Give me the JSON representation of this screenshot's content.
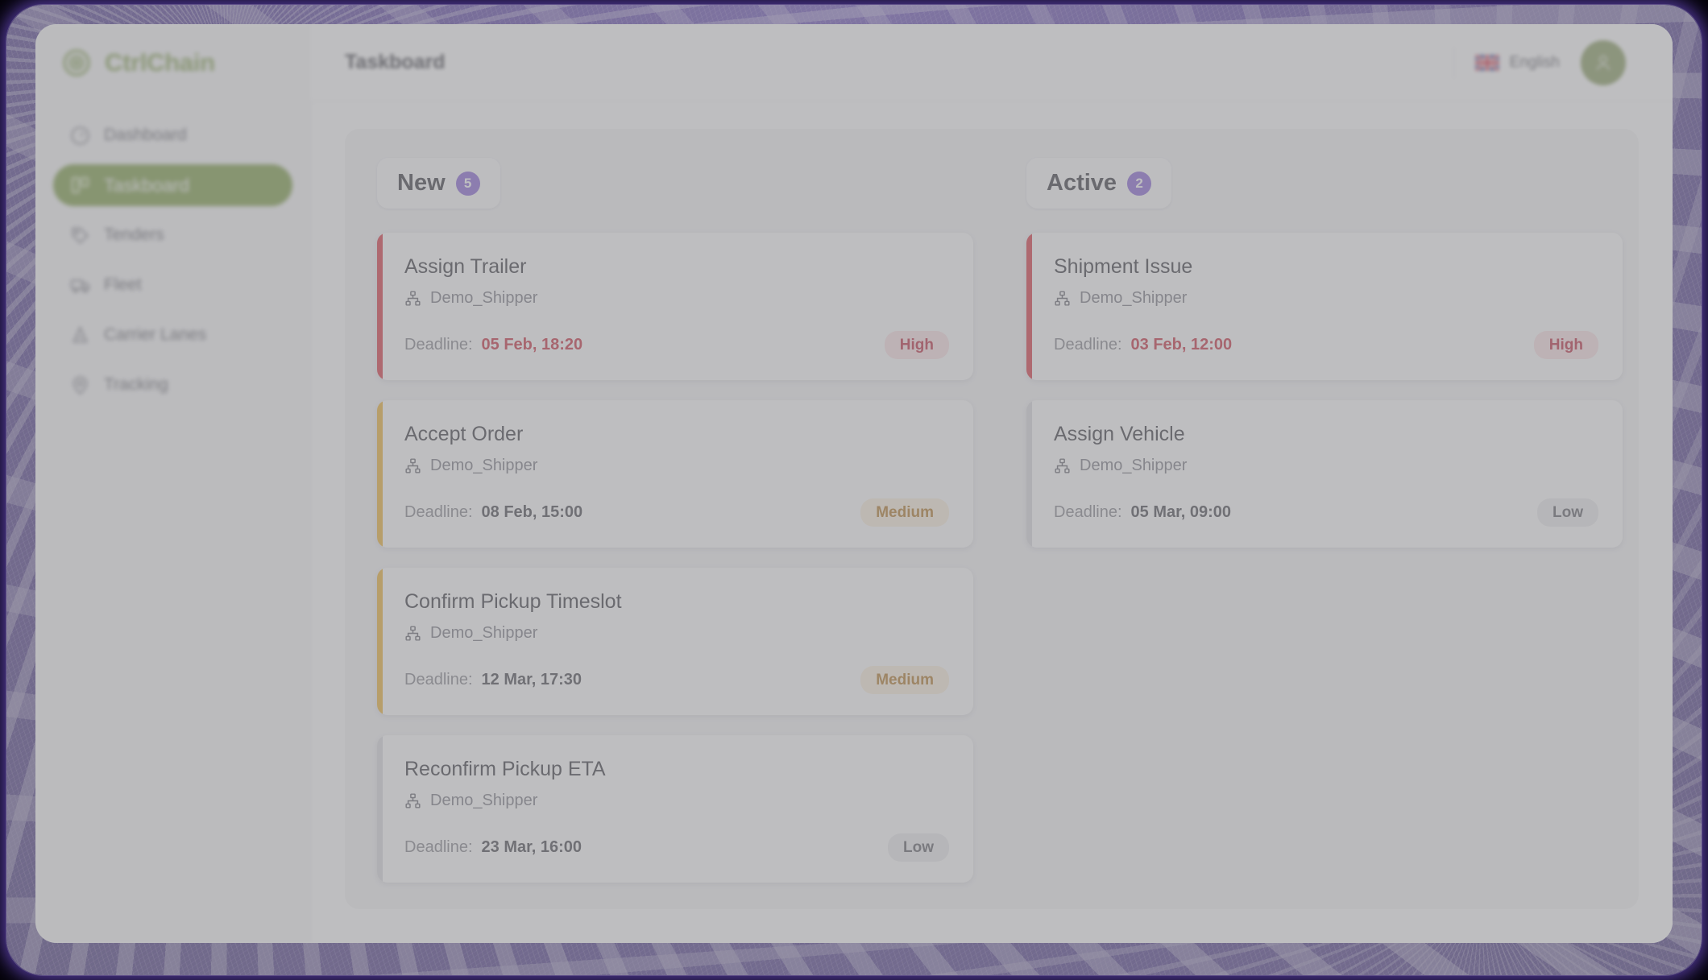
{
  "brand": {
    "name": "CtrlChain",
    "logo_icon": "target-circle-icon",
    "color": "#7b9a43"
  },
  "sidebar": {
    "items": [
      {
        "label": "Dashboard",
        "icon": "gauge-icon",
        "active": false
      },
      {
        "label": "Taskboard",
        "icon": "kanban-icon",
        "active": true
      },
      {
        "label": "Tenders",
        "icon": "tag-icon",
        "active": false
      },
      {
        "label": "Fleet",
        "icon": "truck-icon",
        "active": false
      },
      {
        "label": "Carrier Lanes",
        "icon": "route-icon",
        "active": false
      },
      {
        "label": "Tracking",
        "icon": "location-icon",
        "active": false
      }
    ],
    "active_color": "#6f9331"
  },
  "topbar": {
    "title": "Taskboard",
    "language": {
      "label": "English",
      "icon": "uk-flag-icon"
    },
    "avatar": {
      "icon": "user-icon",
      "color": "#7d9350"
    }
  },
  "board": {
    "badge_color": "#7b55d3",
    "columns": [
      {
        "title": "New",
        "count": "5",
        "cards": [
          {
            "title": "Assign Trailer",
            "org_icon": "org-chart-icon",
            "org": "Demo_Shipper",
            "deadline_label": "Deadline:",
            "deadline": "05 Feb, 18:20",
            "overdue": true,
            "priority": "High",
            "priority_key": "high",
            "accent": "#d6202f"
          },
          {
            "title": "Accept Order",
            "org_icon": "org-chart-icon",
            "org": "Demo_Shipper",
            "deadline_label": "Deadline:",
            "deadline": "08 Feb, 15:00",
            "overdue": false,
            "priority": "Medium",
            "priority_key": "medium",
            "accent": "#edaa1e"
          },
          {
            "title": "Confirm Pickup Timeslot",
            "org_icon": "org-chart-icon",
            "org": "Demo_Shipper",
            "deadline_label": "Deadline:",
            "deadline": "12 Mar, 17:30",
            "overdue": false,
            "priority": "Medium",
            "priority_key": "medium",
            "accent": "#edaa1e"
          },
          {
            "title": "Reconfirm Pickup ETA",
            "org_icon": "org-chart-icon",
            "org": "Demo_Shipper",
            "deadline_label": "Deadline:",
            "deadline": "23 Mar, 16:00",
            "overdue": false,
            "priority": "Low",
            "priority_key": "low",
            "accent": "#d8d8dc"
          }
        ]
      },
      {
        "title": "Active",
        "count": "2",
        "cards": [
          {
            "title": "Shipment Issue",
            "org_icon": "org-chart-icon",
            "org": "Demo_Shipper",
            "deadline_label": "Deadline:",
            "deadline": "03 Feb, 12:00",
            "overdue": true,
            "priority": "High",
            "priority_key": "high",
            "accent": "#d6202f"
          },
          {
            "title": "Assign Vehicle",
            "org_icon": "org-chart-icon",
            "org": "Demo_Shipper",
            "deadline_label": "Deadline:",
            "deadline": "05 Mar, 09:00",
            "overdue": false,
            "priority": "Low",
            "priority_key": "low",
            "accent": "#d8d8dc"
          }
        ]
      }
    ]
  }
}
